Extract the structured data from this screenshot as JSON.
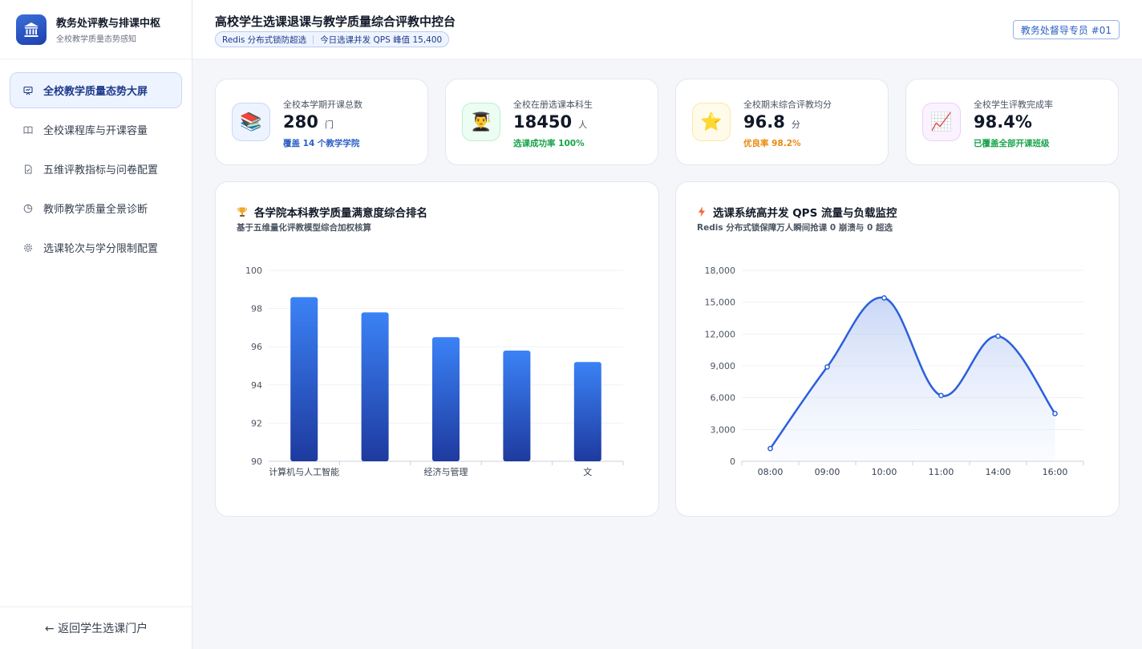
{
  "sidebar": {
    "brand_title": "教务处评教与排课中枢",
    "brand_subtitle": "全校教学质量态势感知",
    "items": [
      {
        "label": "全校教学质量态势大屏",
        "icon": "monitor-icon",
        "active": true
      },
      {
        "label": "全校课程库与开课容量",
        "icon": "book-icon",
        "active": false
      },
      {
        "label": "五维评教指标与问卷配置",
        "icon": "document-icon",
        "active": false
      },
      {
        "label": "教师教学质量全景诊断",
        "icon": "pie-icon",
        "active": false
      },
      {
        "label": "选课轮次与学分限制配置",
        "icon": "gear-icon",
        "active": false
      }
    ],
    "back_label": "← 返回学生选课门户"
  },
  "header": {
    "title": "高校学生选课退课与教学质量综合评教中控台",
    "pill_left": "Redis 分布式锁防超选",
    "pill_right": "今日选课并发 QPS 峰值 15,400",
    "user": "教务处督导专员 #01"
  },
  "stats": [
    {
      "label": "全校本学期开课总数",
      "value": "280",
      "unit": "门",
      "note": "覆盖 14 个教学学院",
      "note_color": "#2b5fc4",
      "icon": "books-icon",
      "glyph": "📚",
      "bg": "#eef4ff",
      "border": "#c7d7f5"
    },
    {
      "label": "全校在册选课本科生",
      "value": "18450",
      "unit": "人",
      "note": "选课成功率 100%",
      "note_color": "#16a34a",
      "icon": "graduate-icon",
      "glyph": "👨‍🎓",
      "bg": "#ecfdf3",
      "border": "#bbf0cf"
    },
    {
      "label": "全校期末综合评教均分",
      "value": "96.8",
      "unit": "分",
      "note": "优良率 98.2%",
      "note_color": "#ea8a0c",
      "icon": "star-icon",
      "glyph": "⭐",
      "bg": "#fffbea",
      "border": "#fde7a3"
    },
    {
      "label": "全校学生评教完成率",
      "value": "98.4%",
      "unit": "",
      "note": "已覆盖全部开课班级",
      "note_color": "#16a34a",
      "icon": "trend-chart-icon",
      "glyph": "📈",
      "bg": "#fbf2ff",
      "border": "#ecd0f7"
    }
  ],
  "panels": {
    "left_title": "各学院本科教学质量满意度综合排名",
    "left_sub": "基于五维量化评教模型综合加权核算",
    "right_title": "选课系统高并发 QPS 流量与负载监控",
    "right_sub": "Redis 分布式锁保障万人瞬间抢课 0 崩溃与 0 超选"
  },
  "chart_data": [
    {
      "type": "bar",
      "categories": [
        "计算机与人工智能",
        "",
        "经济与管理",
        "",
        "文"
      ],
      "values": [
        98.6,
        97.8,
        96.5,
        95.8,
        95.2
      ],
      "ylim": [
        90,
        100
      ],
      "yticks": [
        90,
        92,
        94,
        96,
        98,
        100
      ],
      "title": "",
      "xlabel": "",
      "ylabel": "",
      "grid": true,
      "colors": {
        "top": "#3b82f6",
        "bottom": "#1e3a9f"
      }
    },
    {
      "type": "line",
      "x": [
        "08:00",
        "09:00",
        "10:00",
        "11:00",
        "14:00",
        "16:00"
      ],
      "values": [
        1200,
        8900,
        15400,
        6200,
        11800,
        4500
      ],
      "ylim": [
        0,
        18000
      ],
      "yticks": [
        "0",
        "3,000",
        "6,000",
        "9,000",
        "12,000",
        "15,000",
        "18,000"
      ],
      "title": "",
      "xlabel": "",
      "ylabel": "",
      "grid": true,
      "area": true,
      "colors": {
        "line": "#2b5fdb"
      }
    }
  ]
}
